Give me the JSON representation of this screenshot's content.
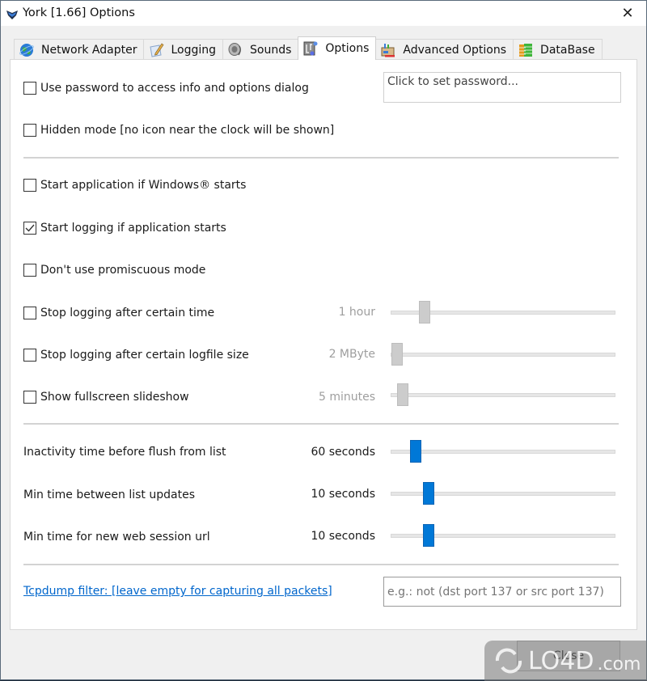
{
  "window": {
    "title": "York [1.66] Options",
    "close_glyph": "✕"
  },
  "tabs": [
    {
      "label": "Network Adapter",
      "icon": "globe-icon",
      "active": false
    },
    {
      "label": "Logging",
      "icon": "notepad-pencil-icon",
      "active": false
    },
    {
      "label": "Sounds",
      "icon": "speaker-icon",
      "active": false
    },
    {
      "label": "Options",
      "icon": "options-icon",
      "active": true
    },
    {
      "label": "Advanced Options",
      "icon": "toolbox-icon",
      "active": false
    },
    {
      "label": "DataBase",
      "icon": "database-icon",
      "active": false
    }
  ],
  "options": {
    "password": {
      "label": "Use password to access info and options dialog",
      "checked": false,
      "field_text": "Click to set password..."
    },
    "hidden_mode": {
      "label": "Hidden mode [no icon near the clock will be shown]",
      "checked": false
    },
    "start_with_windows": {
      "label": "Start application if Windows® starts",
      "checked": false
    },
    "start_logging": {
      "label": "Start logging if application starts",
      "checked": true
    },
    "no_promiscuous": {
      "label": "Don't use promiscuous mode",
      "checked": false
    },
    "stop_after_time": {
      "label": "Stop logging after certain time",
      "checked": false,
      "value_text": "1 hour",
      "slider_fraction": 0.15,
      "enabled": false
    },
    "stop_after_size": {
      "label": "Stop logging after certain logfile size",
      "checked": false,
      "value_text": "2 MByte",
      "slider_fraction": 0.03,
      "enabled": false
    },
    "slideshow": {
      "label": "Show fullscreen slideshow",
      "checked": false,
      "value_text": "5 minutes",
      "slider_fraction": 0.055,
      "enabled": false
    }
  },
  "timings": [
    {
      "label": "Inactivity time before flush from list",
      "value_text": "60 seconds",
      "slider_fraction": 0.11
    },
    {
      "label": "Min time between list updates",
      "value_text": "10 seconds",
      "slider_fraction": 0.17
    },
    {
      "label": "Min time for new web session url",
      "value_text": "10 seconds",
      "slider_fraction": 0.17
    }
  ],
  "tcpdump": {
    "link_text": "Tcpdump filter: [leave empty for capturing all packets]",
    "placeholder": "e.g.: not (dst port 137 or src port 137)"
  },
  "footer": {
    "close_label": "Close"
  },
  "watermark": {
    "text": "LO4D",
    "suffix": ".com"
  },
  "colors": {
    "accent": "#0078d7",
    "disabled_thumb": "#cccccc",
    "link": "#0066cc"
  }
}
